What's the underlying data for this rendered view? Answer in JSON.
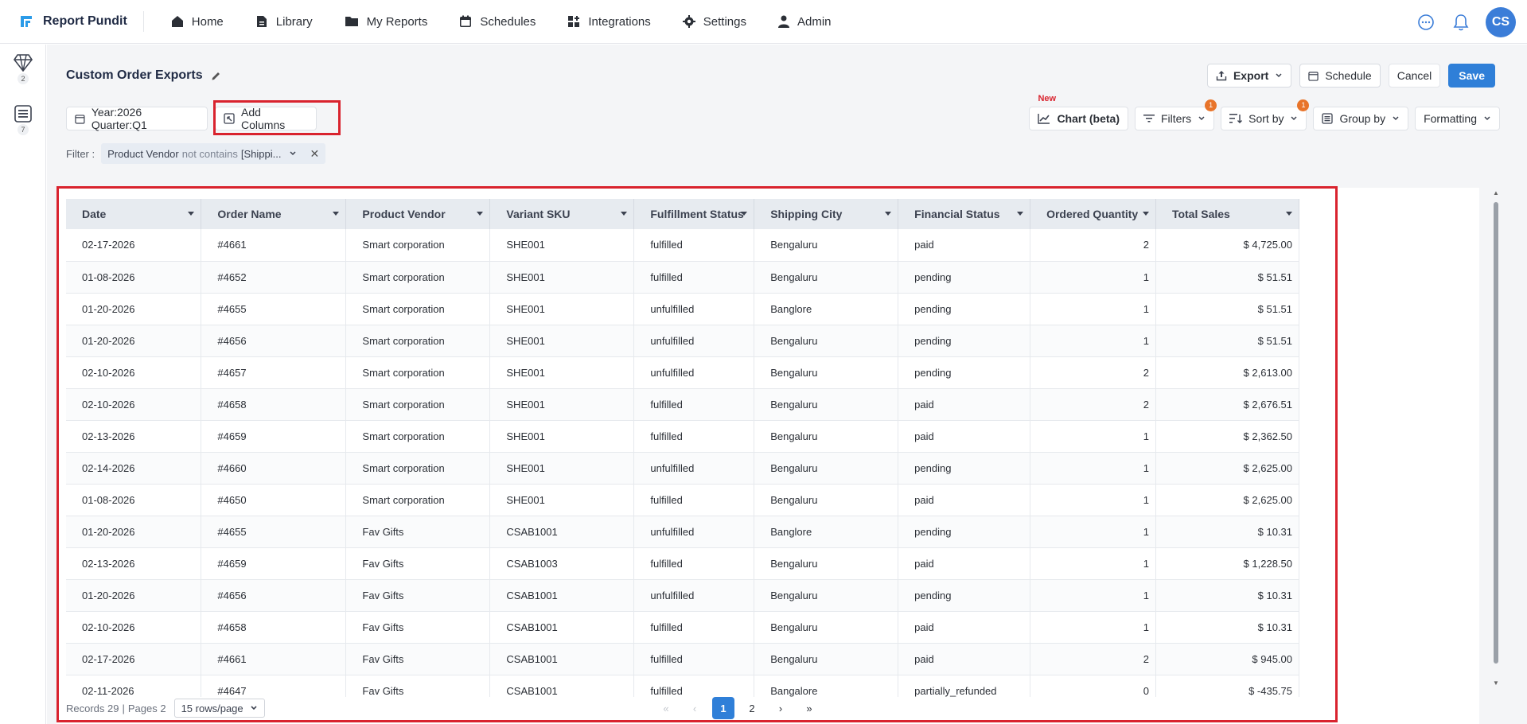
{
  "app": {
    "name": "Report Pundit"
  },
  "nav": [
    {
      "label": "Home",
      "icon": "home-icon"
    },
    {
      "label": "Library",
      "icon": "library-icon"
    },
    {
      "label": "My Reports",
      "icon": "folder-icon"
    },
    {
      "label": "Schedules",
      "icon": "calendar-icon"
    },
    {
      "label": "Integrations",
      "icon": "integrations-icon"
    },
    {
      "label": "Settings",
      "icon": "gear-icon"
    },
    {
      "label": "Admin",
      "icon": "user-icon"
    }
  ],
  "user": {
    "initials": "CS"
  },
  "rail": [
    {
      "icon": "diamond-icon",
      "count": "2"
    },
    {
      "icon": "list-icon",
      "count": "7"
    }
  ],
  "report": {
    "title": "Custom Order Exports",
    "actions": {
      "export": "Export",
      "schedule": "Schedule",
      "cancel": "Cancel",
      "save": "Save"
    },
    "period_chip": "Year:2026 Quarter:Q1",
    "add_columns": "Add Columns",
    "toolbar": {
      "new_tag": "New",
      "chart": "Chart (beta)",
      "filters": "Filters",
      "filters_count": "1",
      "sort": "Sort by",
      "sort_count": "1",
      "group": "Group by",
      "formatting": "Formatting"
    },
    "filter": {
      "label": "Filter :",
      "field": "Product Vendor",
      "operator": "not contains",
      "value": "[Shippi..."
    }
  },
  "colors": {
    "accent": "#2f7fd8",
    "highlight": "#d9232e",
    "badge": "#e8742a"
  },
  "table": {
    "columns": [
      "Date",
      "Order Name",
      "Product Vendor",
      "Variant SKU",
      "Fulfillment Status",
      "Shipping City",
      "Financial Status",
      "Ordered Quantity",
      "Total Sales"
    ],
    "rows": [
      [
        "02-17-2026",
        "#4661",
        "Smart corporation",
        "SHE001",
        "fulfilled",
        "Bengaluru",
        "paid",
        "2",
        "$ 4,725.00"
      ],
      [
        "01-08-2026",
        "#4652",
        "Smart corporation",
        "SHE001",
        "fulfilled",
        "Bengaluru",
        "pending",
        "1",
        "$ 51.51"
      ],
      [
        "01-20-2026",
        "#4655",
        "Smart corporation",
        "SHE001",
        "unfulfilled",
        "Banglore",
        "pending",
        "1",
        "$ 51.51"
      ],
      [
        "01-20-2026",
        "#4656",
        "Smart corporation",
        "SHE001",
        "unfulfilled",
        "Bengaluru",
        "pending",
        "1",
        "$ 51.51"
      ],
      [
        "02-10-2026",
        "#4657",
        "Smart corporation",
        "SHE001",
        "unfulfilled",
        "Bengaluru",
        "pending",
        "2",
        "$ 2,613.00"
      ],
      [
        "02-10-2026",
        "#4658",
        "Smart corporation",
        "SHE001",
        "fulfilled",
        "Bengaluru",
        "paid",
        "2",
        "$ 2,676.51"
      ],
      [
        "02-13-2026",
        "#4659",
        "Smart corporation",
        "SHE001",
        "fulfilled",
        "Bengaluru",
        "paid",
        "1",
        "$ 2,362.50"
      ],
      [
        "02-14-2026",
        "#4660",
        "Smart corporation",
        "SHE001",
        "unfulfilled",
        "Bengaluru",
        "pending",
        "1",
        "$ 2,625.00"
      ],
      [
        "01-08-2026",
        "#4650",
        "Smart corporation",
        "SHE001",
        "fulfilled",
        "Bengaluru",
        "paid",
        "1",
        "$ 2,625.00"
      ],
      [
        "01-20-2026",
        "#4655",
        "Fav Gifts",
        "CSAB1001",
        "unfulfilled",
        "Banglore",
        "pending",
        "1",
        "$ 10.31"
      ],
      [
        "02-13-2026",
        "#4659",
        "Fav Gifts",
        "CSAB1003",
        "fulfilled",
        "Bengaluru",
        "paid",
        "1",
        "$ 1,228.50"
      ],
      [
        "01-20-2026",
        "#4656",
        "Fav Gifts",
        "CSAB1001",
        "unfulfilled",
        "Bengaluru",
        "pending",
        "1",
        "$ 10.31"
      ],
      [
        "02-10-2026",
        "#4658",
        "Fav Gifts",
        "CSAB1001",
        "fulfilled",
        "Bengaluru",
        "paid",
        "1",
        "$ 10.31"
      ],
      [
        "02-17-2026",
        "#4661",
        "Fav Gifts",
        "CSAB1001",
        "fulfilled",
        "Bengaluru",
        "paid",
        "2",
        "$ 945.00"
      ],
      [
        "02-11-2026",
        "#4647",
        "Fav Gifts",
        "CSAB1001",
        "fulfilled",
        "Bangalore",
        "partially_refunded",
        "0",
        "$ -435.75"
      ]
    ]
  },
  "pagination": {
    "records": "Records 29",
    "pages": "Pages 2",
    "rows_per_page": "15 rows/page",
    "pages_list": [
      "1",
      "2"
    ],
    "current": "1"
  }
}
